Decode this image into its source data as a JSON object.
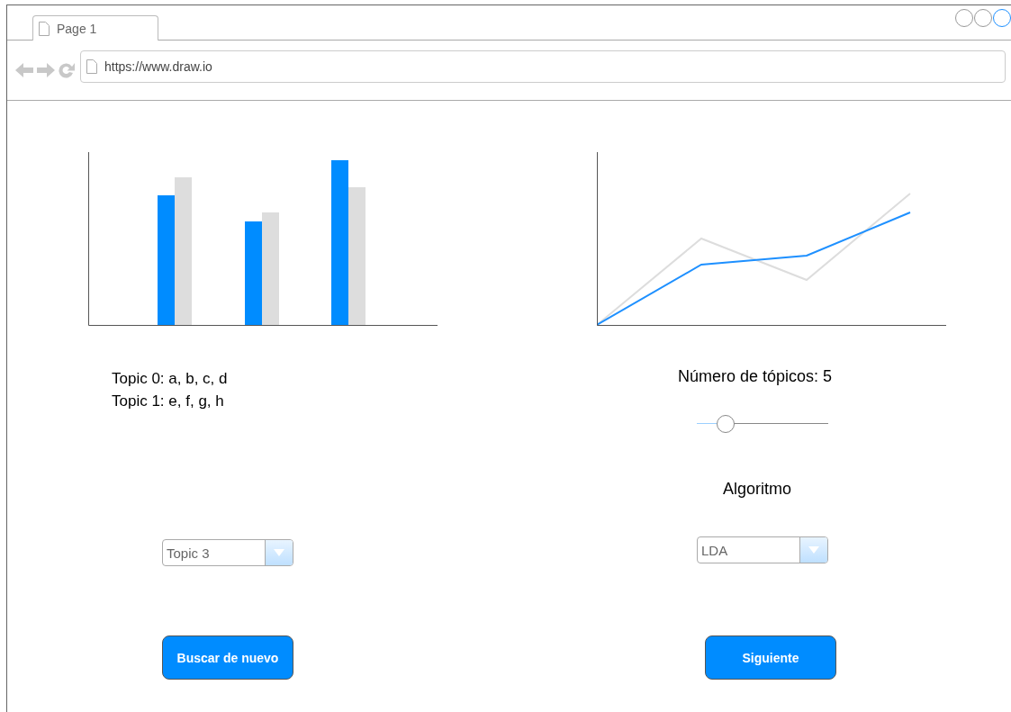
{
  "browser": {
    "tab": {
      "label": "Page 1"
    },
    "url": "https://www.draw.io"
  },
  "left_panel": {
    "topics": [
      "Topic 0: a, b, c, d",
      "Topic 1: e, f, g, h"
    ],
    "topic_dropdown": {
      "value": "Topic 3"
    },
    "button": {
      "label": "Buscar de nuevo"
    }
  },
  "right_panel": {
    "topics_label": "Número de tópicos: 5",
    "topics_slider": {
      "level": 0.22
    },
    "algorithm_label": "Algoritmo",
    "algorithm_dropdown": {
      "value": "LDA"
    },
    "button": {
      "label": "Siguiente"
    }
  }
}
